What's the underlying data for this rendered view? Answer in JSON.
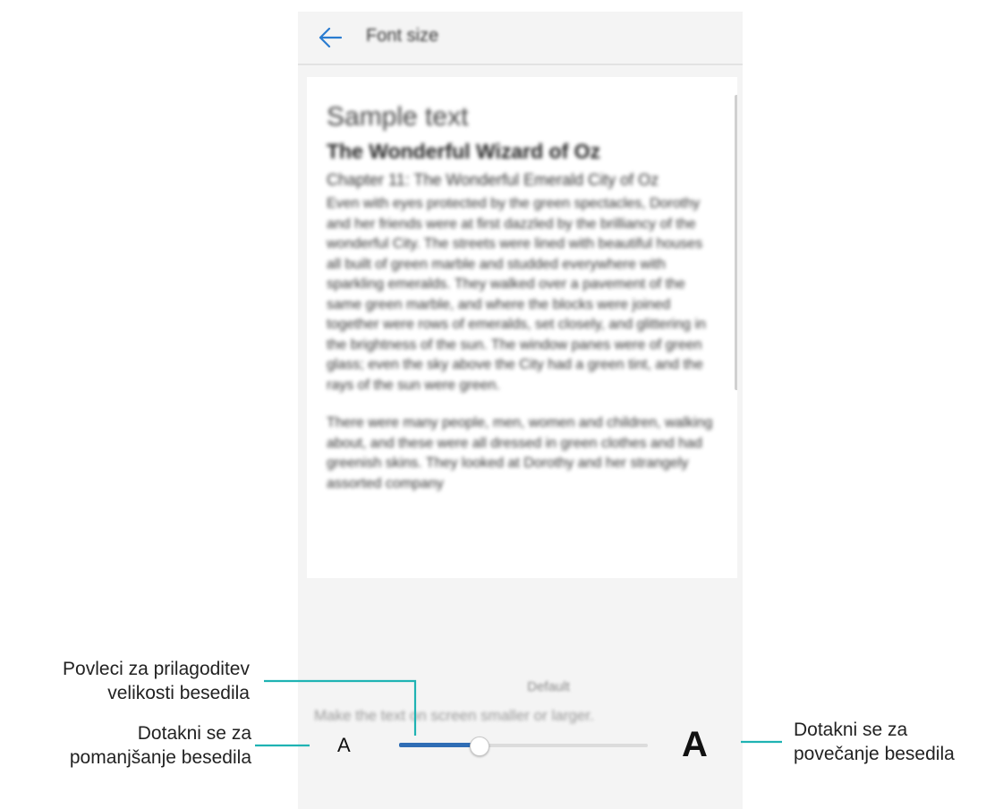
{
  "header": {
    "title": "Font size",
    "back_icon": "back-arrow-icon"
  },
  "sample": {
    "heading": "Sample text",
    "book_title": "The Wonderful Wizard of Oz",
    "chapter": "Chapter 11: The Wonderful Emerald City of Oz",
    "paragraphs": [
      "Even with eyes protected by the green spectacles, Dorothy and her friends were at first dazzled by the brilliancy of the wonderful City. The streets were lined with beautiful houses all built of green marble and studded everywhere with sparkling emeralds. They walked over a pavement of the same green marble, and where the blocks were joined together were rows of emeralds, set closely, and glittering in the brightness of the sun. The window panes were of green glass; even the sky above the City had a green tint, and the rays of the sun were green.",
      "There were many people, men, women and children, walking about, and these were all dressed in green clothes and had greenish skins. They looked at Dorothy and her strangely assorted company"
    ]
  },
  "font_control": {
    "level_label": "Default",
    "decrease_label": "A",
    "increase_label": "A",
    "helper": "Make the text on screen smaller or larger.",
    "slider_value": 0.32,
    "slider_color": "#2f6db5"
  },
  "annotations": {
    "drag_slider_line1": "Povleci za prilagoditev",
    "drag_slider_line2": "velikosti besedila",
    "decrease_line1": "Dotakni se za",
    "decrease_line2": "pomanjšanje besedila",
    "increase_line1": "Dotakni se za",
    "increase_line2": "povečanje besedila",
    "line_color": "#1fb3b3"
  }
}
